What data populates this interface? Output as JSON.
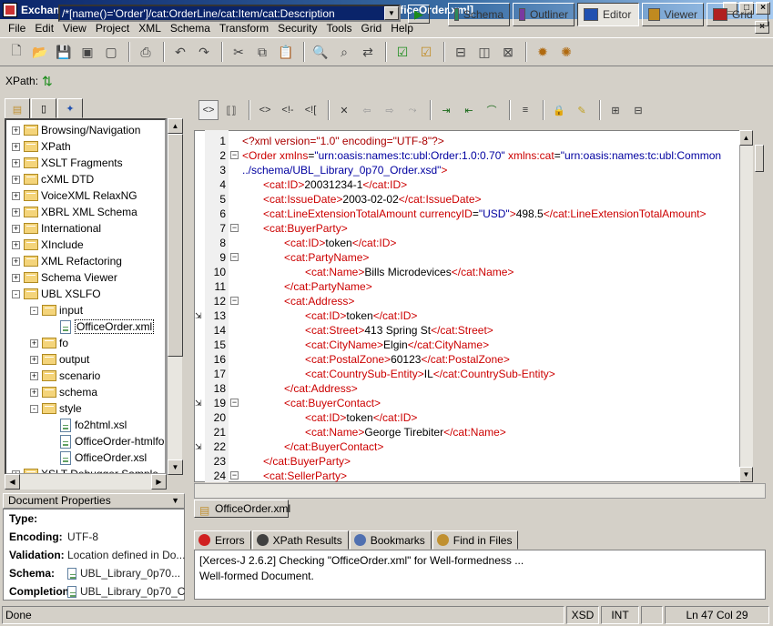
{
  "window": {
    "title": "Exchanger XML Editor - [C:/dev/xngr-editor/projects/UBL XSLFO/input/OfficeOrder.xml]"
  },
  "menu": [
    "File",
    "Edit",
    "View",
    "Project",
    "XML",
    "Schema",
    "Transform",
    "Security",
    "Tools",
    "Grid",
    "Help"
  ],
  "xpath": {
    "label": "XPath:",
    "value": "/*[name()='Order']/cat:OrderLine/cat:Item/cat:Description"
  },
  "views": [
    {
      "label": "Schema",
      "color": "#2a8a5a"
    },
    {
      "label": "Outliner",
      "color": "#7a3aa0"
    },
    {
      "label": "Editor",
      "color": "#2050b0"
    },
    {
      "label": "Viewer",
      "color": "#c08a20"
    },
    {
      "label": "Grid",
      "color": "#b02020"
    }
  ],
  "tree": [
    {
      "label": "Browsing/Navigation",
      "depth": 0,
      "type": "folder",
      "exp": "+"
    },
    {
      "label": "XPath",
      "depth": 0,
      "type": "folder",
      "exp": "+"
    },
    {
      "label": "XSLT Fragments",
      "depth": 0,
      "type": "folder",
      "exp": "+"
    },
    {
      "label": "cXML DTD",
      "depth": 0,
      "type": "folder",
      "exp": "+"
    },
    {
      "label": "VoiceXML RelaxNG",
      "depth": 0,
      "type": "folder",
      "exp": "+"
    },
    {
      "label": "XBRL XML Schema",
      "depth": 0,
      "type": "folder",
      "exp": "+"
    },
    {
      "label": "International",
      "depth": 0,
      "type": "folder",
      "exp": "+"
    },
    {
      "label": "XInclude",
      "depth": 0,
      "type": "folder",
      "exp": "+"
    },
    {
      "label": "XML Refactoring",
      "depth": 0,
      "type": "folder",
      "exp": "+"
    },
    {
      "label": "Schema Viewer",
      "depth": 0,
      "type": "folder",
      "exp": "+"
    },
    {
      "label": "UBL XSLFO",
      "depth": 0,
      "type": "folder",
      "exp": "-"
    },
    {
      "label": "input",
      "depth": 1,
      "type": "folder",
      "exp": "-"
    },
    {
      "label": "OfficeOrder.xml",
      "depth": 2,
      "type": "file",
      "exp": "",
      "selected": true
    },
    {
      "label": "fo",
      "depth": 1,
      "type": "folder",
      "exp": "+"
    },
    {
      "label": "output",
      "depth": 1,
      "type": "folder",
      "exp": "+"
    },
    {
      "label": "scenario",
      "depth": 1,
      "type": "folder",
      "exp": "+"
    },
    {
      "label": "schema",
      "depth": 1,
      "type": "folder",
      "exp": "+"
    },
    {
      "label": "style",
      "depth": 1,
      "type": "folder",
      "exp": "-"
    },
    {
      "label": "fo2html.xsl",
      "depth": 2,
      "type": "file",
      "exp": ""
    },
    {
      "label": "OfficeOrder-htmlfo.xs",
      "depth": 2,
      "type": "file",
      "exp": ""
    },
    {
      "label": "OfficeOrder.xsl",
      "depth": 2,
      "type": "file",
      "exp": ""
    },
    {
      "label": "XSLT Debugger Sample",
      "depth": 0,
      "type": "folder",
      "exp": "+"
    }
  ],
  "properties": {
    "header": "Document Properties",
    "rows": [
      {
        "key": "Type:",
        "value": ""
      },
      {
        "key": "Encoding:",
        "value": "UTF-8"
      },
      {
        "key": "Validation:",
        "value": "Location defined in Do..."
      },
      {
        "key": "Schema:",
        "value": "UBL_Library_0p70..."
      },
      {
        "key": "Completion:",
        "value": "UBL_Library_0p70_C"
      }
    ]
  },
  "code_lines": [
    {
      "n": "1",
      "indent": 0,
      "fold": "",
      "parts": [
        [
          "pi",
          "<?xml version=\"1.0\" encoding=\"UTF-8\"?>"
        ]
      ]
    },
    {
      "n": "2",
      "indent": 0,
      "fold": "-",
      "parts": [
        [
          "tag",
          "<Order"
        ],
        [
          "attr",
          " xmlns"
        ],
        [
          "txt",
          "="
        ],
        [
          "aval",
          "\"urn:oasis:names:tc:ubl:Order:1.0:0.70\""
        ],
        [
          "attr",
          " xmlns:cat"
        ],
        [
          "txt",
          "="
        ],
        [
          "aval",
          "\"urn:oasis:names:tc:ubl:Common"
        ]
      ]
    },
    {
      "n": "3",
      "indent": 0,
      "fold": "",
      "parts": [
        [
          "aval",
          "../schema/UBL_Library_0p70_Order.xsd\""
        ],
        [
          "tag",
          ">"
        ]
      ]
    },
    {
      "n": "4",
      "indent": 1,
      "fold": "",
      "parts": [
        [
          "tag",
          "<cat:ID>"
        ],
        [
          "txt",
          "20031234-1"
        ],
        [
          "tag",
          "</cat:ID>"
        ]
      ]
    },
    {
      "n": "5",
      "indent": 1,
      "fold": "",
      "parts": [
        [
          "tag",
          "<cat:IssueDate>"
        ],
        [
          "txt",
          "2003-02-02"
        ],
        [
          "tag",
          "</cat:IssueDate>"
        ]
      ]
    },
    {
      "n": "6",
      "indent": 1,
      "fold": "",
      "parts": [
        [
          "tag",
          "<cat:LineExtensionTotalAmount"
        ],
        [
          "attr",
          " currencyID"
        ],
        [
          "txt",
          "="
        ],
        [
          "aval",
          "\"USD\""
        ],
        [
          "tag",
          ">"
        ],
        [
          "txt",
          "498.5"
        ],
        [
          "tag",
          "</cat:LineExtensionTotalAmount>"
        ]
      ]
    },
    {
      "n": "7",
      "indent": 1,
      "fold": "-",
      "parts": [
        [
          "tag",
          "<cat:BuyerParty>"
        ]
      ]
    },
    {
      "n": "8",
      "indent": 2,
      "fold": "",
      "parts": [
        [
          "tag",
          "<cat:ID>"
        ],
        [
          "txt",
          "token"
        ],
        [
          "tag",
          "</cat:ID>"
        ]
      ]
    },
    {
      "n": "9",
      "indent": 2,
      "fold": "-",
      "parts": [
        [
          "tag",
          "<cat:PartyName>"
        ]
      ]
    },
    {
      "n": "10",
      "indent": 3,
      "fold": "",
      "parts": [
        [
          "tag",
          "<cat:Name>"
        ],
        [
          "txt",
          "Bills Microdevices"
        ],
        [
          "tag",
          "</cat:Name>"
        ]
      ]
    },
    {
      "n": "11",
      "indent": 2,
      "fold": "",
      "parts": [
        [
          "tag",
          "</cat:PartyName>"
        ]
      ]
    },
    {
      "n": "12",
      "indent": 2,
      "fold": "-",
      "parts": [
        [
          "tag",
          "<cat:Address>"
        ]
      ]
    },
    {
      "n": "13",
      "indent": 3,
      "fold": "",
      "parts": [
        [
          "tag",
          "<cat:ID>"
        ],
        [
          "txt",
          "token"
        ],
        [
          "tag",
          "</cat:ID>"
        ]
      ]
    },
    {
      "n": "14",
      "indent": 3,
      "fold": "",
      "parts": [
        [
          "tag",
          "<cat:Street>"
        ],
        [
          "txt",
          "413 Spring St"
        ],
        [
          "tag",
          "</cat:Street>"
        ]
      ]
    },
    {
      "n": "15",
      "indent": 3,
      "fold": "",
      "parts": [
        [
          "tag",
          "<cat:CityName>"
        ],
        [
          "txt",
          "Elgin"
        ],
        [
          "tag",
          "</cat:CityName>"
        ]
      ]
    },
    {
      "n": "16",
      "indent": 3,
      "fold": "",
      "parts": [
        [
          "tag",
          "<cat:PostalZone>"
        ],
        [
          "txt",
          "60123"
        ],
        [
          "tag",
          "</cat:PostalZone>"
        ]
      ]
    },
    {
      "n": "17",
      "indent": 3,
      "fold": "",
      "parts": [
        [
          "tag",
          "<cat:CountrySub-Entity>"
        ],
        [
          "txt",
          "IL"
        ],
        [
          "tag",
          "</cat:CountrySub-Entity>"
        ]
      ]
    },
    {
      "n": "18",
      "indent": 2,
      "fold": "",
      "parts": [
        [
          "tag",
          "</cat:Address>"
        ]
      ]
    },
    {
      "n": "19",
      "indent": 2,
      "fold": "-",
      "parts": [
        [
          "tag",
          "<cat:BuyerContact>"
        ]
      ]
    },
    {
      "n": "20",
      "indent": 3,
      "fold": "",
      "parts": [
        [
          "tag",
          "<cat:ID>"
        ],
        [
          "txt",
          "token"
        ],
        [
          "tag",
          "</cat:ID>"
        ]
      ]
    },
    {
      "n": "21",
      "indent": 3,
      "fold": "",
      "parts": [
        [
          "tag",
          "<cat:Name>"
        ],
        [
          "txt",
          "George Tirebiter"
        ],
        [
          "tag",
          "</cat:Name>"
        ]
      ]
    },
    {
      "n": "22",
      "indent": 2,
      "fold": "",
      "parts": [
        [
          "tag",
          "</cat:BuyerContact>"
        ]
      ]
    },
    {
      "n": "23",
      "indent": 1,
      "fold": "",
      "parts": [
        [
          "tag",
          "</cat:BuyerParty>"
        ]
      ]
    },
    {
      "n": "24",
      "indent": 1,
      "fold": "-",
      "parts": [
        [
          "tag",
          "<cat:SellerParty>"
        ]
      ]
    }
  ],
  "doc_tab": "OfficeOrder.xml",
  "bottom_tabs": [
    {
      "label": "Errors",
      "color": "#d02020"
    },
    {
      "label": "XPath Results",
      "color": "#404040"
    },
    {
      "label": "Bookmarks",
      "color": "#5070b0"
    },
    {
      "label": "Find in Files",
      "color": "#c09030"
    }
  ],
  "output": [
    "[Xerces-J 2.6.2] Checking \"OfficeOrder.xml\" for Well-formedness ...",
    "Well-formed Document."
  ],
  "status": {
    "left": "Done",
    "xsd": "XSD",
    "int": "INT",
    "position": "Ln 47 Col 29"
  }
}
